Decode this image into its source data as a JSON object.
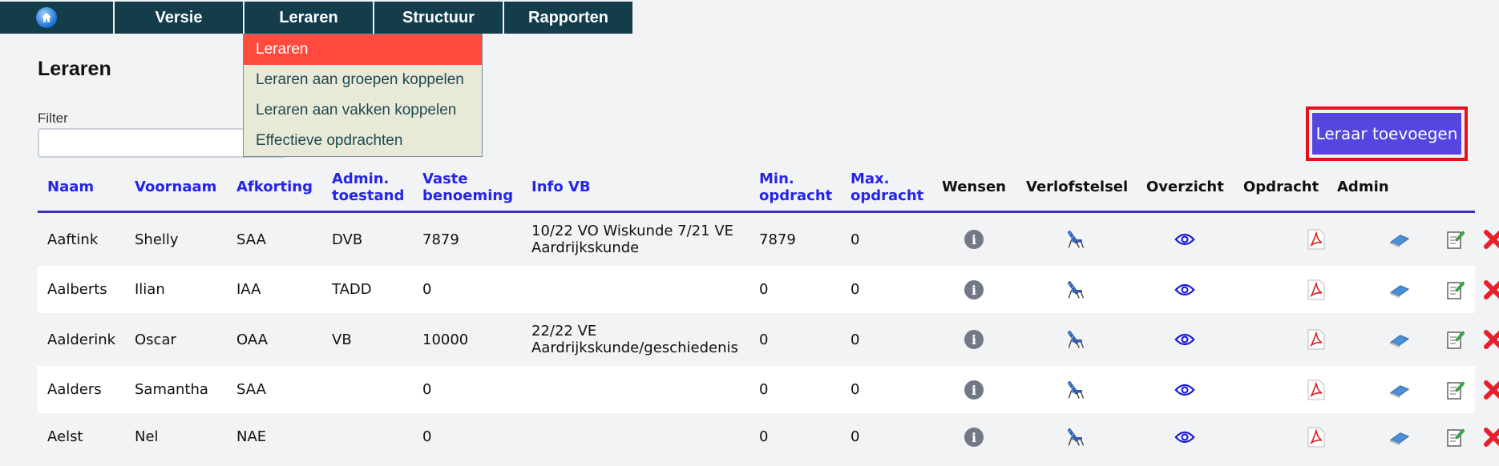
{
  "nav": {
    "items": [
      {
        "label": "Versie"
      },
      {
        "label": "Leraren"
      },
      {
        "label": "Structuur"
      },
      {
        "label": "Rapporten"
      }
    ]
  },
  "dropdown": {
    "items": [
      {
        "label": "Leraren",
        "active": true
      },
      {
        "label": "Leraren aan groepen koppelen"
      },
      {
        "label": "Leraren aan vakken koppelen"
      },
      {
        "label": "Effectieve opdrachten"
      }
    ]
  },
  "page": {
    "title": "Leraren",
    "filter_label": "Filter",
    "filter_value": "",
    "add_button": "Leraar toevoegen"
  },
  "table": {
    "headers": {
      "naam": "Naam",
      "voornaam": "Voornaam",
      "afkorting": "Afkorting",
      "admin_line1": "Admin.",
      "admin_line2": "toestand",
      "vaste_line1": "Vaste",
      "vaste_line2": "benoeming",
      "info_vb": "Info VB",
      "min_line1": "Min.",
      "min_line2": "opdracht",
      "max_line1": "Max.",
      "max_line2": "opdracht",
      "wensen": "Wensen",
      "verlofstelsel": "Verlofstelsel",
      "overzicht": "Overzicht",
      "opdracht": "Opdracht",
      "admin": "Admin"
    },
    "rows": [
      {
        "naam": "Aaftink",
        "voornaam": "Shelly",
        "afkorting": "SAA",
        "admin": "DVB",
        "vaste": "7879",
        "info1": "10/22 VO Wiskunde 7/21 VE",
        "info2": "Aardrijkskunde",
        "min": "7879",
        "max": "0"
      },
      {
        "naam": "Aalberts",
        "voornaam": "Ilian",
        "afkorting": "IAA",
        "admin": "TADD",
        "vaste": "0",
        "info1": "",
        "info2": "",
        "min": "0",
        "max": "0"
      },
      {
        "naam": "Aalderink",
        "voornaam": "Oscar",
        "afkorting": "OAA",
        "admin": "VB",
        "vaste": "10000",
        "info1": "22/22 VE",
        "info2": "Aardrijkskunde/geschiedenis",
        "min": "0",
        "max": "0"
      },
      {
        "naam": "Aalders",
        "voornaam": "Samantha",
        "afkorting": "SAA",
        "admin": "",
        "vaste": "0",
        "info1": "",
        "info2": "",
        "min": "0",
        "max": "0"
      },
      {
        "naam": "Aelst",
        "voornaam": "Nel",
        "afkorting": "NAE",
        "admin": "",
        "vaste": "0",
        "info1": "",
        "info2": "",
        "min": "0",
        "max": "0"
      }
    ]
  },
  "colors": {
    "nav_bg": "#133d4b",
    "dropdown_active": "#ff4a3d",
    "add_button_bg": "#5546e0",
    "add_button_highlight": "#e4121a",
    "header_link": "#2525e8"
  }
}
